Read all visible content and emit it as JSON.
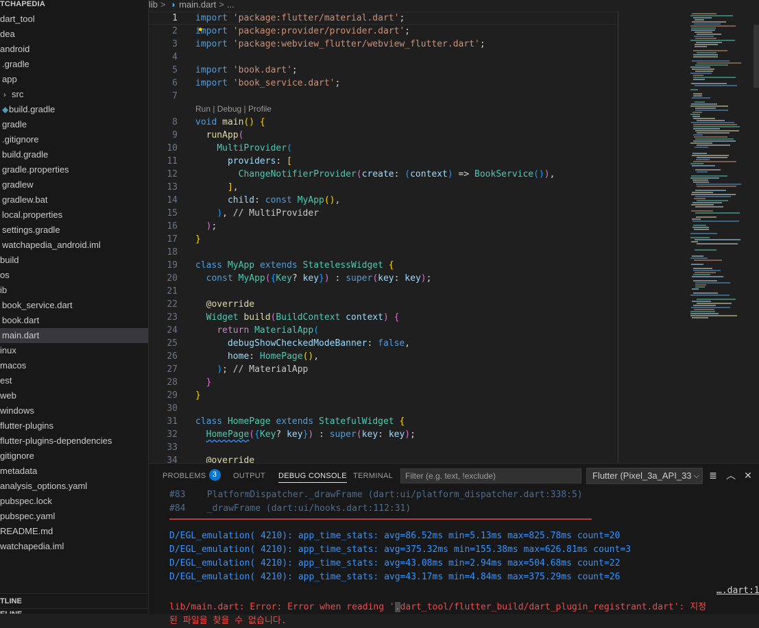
{
  "sidebar": {
    "section_title": "TCHAPEDIA",
    "items": [
      {
        "label": "dart_tool",
        "indent": 0
      },
      {
        "label": "dea",
        "indent": 0
      },
      {
        "label": "android",
        "indent": 0
      },
      {
        "label": ".gradle",
        "indent": 1
      },
      {
        "label": "app",
        "indent": 1
      },
      {
        "label": "src",
        "indent": 2,
        "chevron": true
      },
      {
        "label": "build.gradle",
        "indent": 2,
        "icon": true
      },
      {
        "label": "gradle",
        "indent": 1
      },
      {
        "label": ".gitignore",
        "indent": 1
      },
      {
        "label": "build.gradle",
        "indent": 1
      },
      {
        "label": "gradle.properties",
        "indent": 1
      },
      {
        "label": "gradlew",
        "indent": 1
      },
      {
        "label": "gradlew.bat",
        "indent": 1
      },
      {
        "label": "local.properties",
        "indent": 1
      },
      {
        "label": "settings.gradle",
        "indent": 1
      },
      {
        "label": "watchapedia_android.iml",
        "indent": 1
      },
      {
        "label": "build",
        "indent": 0
      },
      {
        "label": "os",
        "indent": 0
      },
      {
        "label": "ib",
        "indent": 0
      },
      {
        "label": "book_service.dart",
        "indent": 1
      },
      {
        "label": "book.dart",
        "indent": 1
      },
      {
        "label": "main.dart",
        "indent": 1,
        "selected": true
      },
      {
        "label": "inux",
        "indent": 0
      },
      {
        "label": "macos",
        "indent": 0
      },
      {
        "label": "est",
        "indent": 0
      },
      {
        "label": "web",
        "indent": 0
      },
      {
        "label": "windows",
        "indent": 0
      },
      {
        "label": "flutter-plugins",
        "indent": 0
      },
      {
        "label": "flutter-plugins-dependencies",
        "indent": 0
      },
      {
        "label": "gitignore",
        "indent": 0
      },
      {
        "label": "metadata",
        "indent": 0
      },
      {
        "label": "analysis_options.yaml",
        "indent": 0
      },
      {
        "label": "pubspec.lock",
        "indent": 0
      },
      {
        "label": "pubspec.yaml",
        "indent": 0
      },
      {
        "label": "README.md",
        "indent": 0
      },
      {
        "label": "watchapedia.iml",
        "indent": 0
      }
    ],
    "outline_title": "TLINE",
    "timeline_title": "ELINE"
  },
  "breadcrumb": {
    "folder": "lib",
    "file": "main.dart",
    "more": "..."
  },
  "editor": {
    "current_line": 1,
    "codelens": "Run | Debug | Profile",
    "lines": [
      {
        "n": 1,
        "tokens": [
          [
            "kw",
            "import"
          ],
          [
            "plain",
            " "
          ],
          [
            "str",
            "'package:flutter/material.dart'"
          ],
          [
            "plain",
            ";"
          ]
        ]
      },
      {
        "n": 2,
        "tokens": [
          [
            "kw",
            "import"
          ],
          [
            "plain",
            " "
          ],
          [
            "str",
            "'package:provider/provider.dart'"
          ],
          [
            "plain",
            ";"
          ]
        ]
      },
      {
        "n": 3,
        "tokens": [
          [
            "kw",
            "import"
          ],
          [
            "plain",
            " "
          ],
          [
            "str",
            "'package:webview_flutter/webview_flutter.dart'"
          ],
          [
            "plain",
            ";"
          ]
        ]
      },
      {
        "n": 4,
        "tokens": []
      },
      {
        "n": 5,
        "tokens": [
          [
            "kw",
            "import"
          ],
          [
            "plain",
            " "
          ],
          [
            "str",
            "'book.dart'"
          ],
          [
            "plain",
            ";"
          ]
        ]
      },
      {
        "n": 6,
        "tokens": [
          [
            "kw",
            "import"
          ],
          [
            "plain",
            " "
          ],
          [
            "str",
            "'book_service.dart'"
          ],
          [
            "plain",
            ";"
          ]
        ]
      },
      {
        "n": 7,
        "tokens": []
      },
      {
        "n": 8,
        "codelens": true,
        "tokens": [
          [
            "kw",
            "void"
          ],
          [
            "plain",
            " "
          ],
          [
            "fn",
            "main"
          ],
          [
            "b1",
            "()"
          ],
          [
            "plain",
            " "
          ],
          [
            "b1",
            "{"
          ]
        ]
      },
      {
        "n": 9,
        "tokens": [
          [
            "plain",
            "  "
          ],
          [
            "fn",
            "runApp"
          ],
          [
            "b2",
            "("
          ]
        ]
      },
      {
        "n": 10,
        "tokens": [
          [
            "plain",
            "    "
          ],
          [
            "type",
            "MultiProvider"
          ],
          [
            "b3",
            "("
          ]
        ]
      },
      {
        "n": 11,
        "tokens": [
          [
            "plain",
            "      "
          ],
          [
            "var",
            "providers"
          ],
          [
            "plain",
            ": "
          ],
          [
            "b1",
            "["
          ]
        ]
      },
      {
        "n": 12,
        "tokens": [
          [
            "plain",
            "        "
          ],
          [
            "type",
            "ChangeNotifierProvider"
          ],
          [
            "b2",
            "("
          ],
          [
            "var",
            "create"
          ],
          [
            "plain",
            ": "
          ],
          [
            "b3",
            "("
          ],
          [
            "var",
            "context"
          ],
          [
            "b3",
            ")"
          ],
          [
            "plain",
            " => "
          ],
          [
            "type",
            "BookService"
          ],
          [
            "b3",
            "()"
          ],
          [
            "b2",
            ")"
          ],
          [
            "plain",
            ","
          ]
        ]
      },
      {
        "n": 13,
        "tokens": [
          [
            "plain",
            "      "
          ],
          [
            "b1",
            "]"
          ],
          [
            "plain",
            ","
          ]
        ]
      },
      {
        "n": 14,
        "tokens": [
          [
            "plain",
            "      "
          ],
          [
            "var",
            "child"
          ],
          [
            "plain",
            ": "
          ],
          [
            "kw",
            "const"
          ],
          [
            "plain",
            " "
          ],
          [
            "type",
            "MyApp"
          ],
          [
            "b1",
            "()"
          ],
          [
            "plain",
            ","
          ]
        ]
      },
      {
        "n": 15,
        "tokens": [
          [
            "plain",
            "    "
          ],
          [
            "b3",
            ")"
          ],
          [
            "plain",
            ", "
          ],
          [
            "cm",
            "// MultiProvider"
          ]
        ]
      },
      {
        "n": 16,
        "tokens": [
          [
            "plain",
            "  "
          ],
          [
            "b2",
            ")"
          ],
          [
            "plain",
            ";"
          ]
        ]
      },
      {
        "n": 17,
        "tokens": [
          [
            "b1",
            "}"
          ]
        ]
      },
      {
        "n": 18,
        "tokens": []
      },
      {
        "n": 19,
        "tokens": [
          [
            "kw",
            "class"
          ],
          [
            "plain",
            " "
          ],
          [
            "type",
            "MyApp"
          ],
          [
            "plain",
            " "
          ],
          [
            "kw",
            "extends"
          ],
          [
            "plain",
            " "
          ],
          [
            "type",
            "StatelessWidget"
          ],
          [
            "plain",
            " "
          ],
          [
            "b1",
            "{"
          ]
        ]
      },
      {
        "n": 20,
        "tokens": [
          [
            "plain",
            "  "
          ],
          [
            "kw",
            "const"
          ],
          [
            "plain",
            " "
          ],
          [
            "type",
            "MyApp"
          ],
          [
            "b2",
            "("
          ],
          [
            "b3",
            "{"
          ],
          [
            "type",
            "Key"
          ],
          [
            "plain",
            "? "
          ],
          [
            "var",
            "key"
          ],
          [
            "b3",
            "}"
          ],
          [
            "b2",
            ")"
          ],
          [
            "plain",
            " : "
          ],
          [
            "kw",
            "super"
          ],
          [
            "b2",
            "("
          ],
          [
            "var",
            "key"
          ],
          [
            "plain",
            ": "
          ],
          [
            "var",
            "key"
          ],
          [
            "b2",
            ")"
          ],
          [
            "plain",
            ";"
          ]
        ]
      },
      {
        "n": 21,
        "tokens": []
      },
      {
        "n": 22,
        "tokens": [
          [
            "plain",
            "  "
          ],
          [
            "anno",
            "@override"
          ]
        ]
      },
      {
        "n": 23,
        "tokens": [
          [
            "plain",
            "  "
          ],
          [
            "type",
            "Widget"
          ],
          [
            "plain",
            " "
          ],
          [
            "fn",
            "build"
          ],
          [
            "b2",
            "("
          ],
          [
            "type",
            "BuildContext"
          ],
          [
            "plain",
            " "
          ],
          [
            "var",
            "context"
          ],
          [
            "b2",
            ")"
          ],
          [
            "plain",
            " "
          ],
          [
            "b2",
            "{"
          ]
        ]
      },
      {
        "n": 24,
        "tokens": [
          [
            "plain",
            "    "
          ],
          [
            "ctl",
            "return"
          ],
          [
            "plain",
            " "
          ],
          [
            "type",
            "MaterialApp"
          ],
          [
            "b3",
            "("
          ]
        ]
      },
      {
        "n": 25,
        "tokens": [
          [
            "plain",
            "      "
          ],
          [
            "var",
            "debugShowCheckedModeBanner"
          ],
          [
            "plain",
            ": "
          ],
          [
            "kw",
            "false"
          ],
          [
            "plain",
            ","
          ]
        ]
      },
      {
        "n": 26,
        "tokens": [
          [
            "plain",
            "      "
          ],
          [
            "var",
            "home"
          ],
          [
            "plain",
            ": "
          ],
          [
            "type",
            "HomePage"
          ],
          [
            "b1",
            "()"
          ],
          [
            "plain",
            ","
          ]
        ]
      },
      {
        "n": 27,
        "tokens": [
          [
            "plain",
            "    "
          ],
          [
            "b3",
            ")"
          ],
          [
            "plain",
            "; "
          ],
          [
            "cm",
            "// MaterialApp"
          ]
        ]
      },
      {
        "n": 28,
        "tokens": [
          [
            "plain",
            "  "
          ],
          [
            "b2",
            "}"
          ]
        ]
      },
      {
        "n": 29,
        "tokens": [
          [
            "b1",
            "}"
          ]
        ]
      },
      {
        "n": 30,
        "tokens": []
      },
      {
        "n": 31,
        "tokens": [
          [
            "kw",
            "class"
          ],
          [
            "plain",
            " "
          ],
          [
            "type",
            "HomePage"
          ],
          [
            "plain",
            " "
          ],
          [
            "kw",
            "extends"
          ],
          [
            "plain",
            " "
          ],
          [
            "type",
            "StatefulWidget"
          ],
          [
            "plain",
            " "
          ],
          [
            "b1",
            "{"
          ]
        ]
      },
      {
        "n": 32,
        "tokens": [
          [
            "plain",
            "  "
          ],
          [
            "typesq",
            "HomePage"
          ],
          [
            "b2",
            "("
          ],
          [
            "b3",
            "{"
          ],
          [
            "type",
            "Key"
          ],
          [
            "plain",
            "? "
          ],
          [
            "var",
            "key"
          ],
          [
            "b3",
            "}"
          ],
          [
            "b2",
            ")"
          ],
          [
            "plain",
            " : "
          ],
          [
            "kw",
            "super"
          ],
          [
            "b2",
            "("
          ],
          [
            "var",
            "key"
          ],
          [
            "plain",
            ": "
          ],
          [
            "var",
            "key"
          ],
          [
            "b2",
            ")"
          ],
          [
            "plain",
            ";"
          ]
        ]
      },
      {
        "n": 33,
        "tokens": []
      },
      {
        "n": 34,
        "tokens": [
          [
            "plain",
            "  "
          ],
          [
            "anno",
            "@override"
          ]
        ]
      }
    ]
  },
  "panel": {
    "tabs": [
      {
        "label": "PROBLEMS",
        "badge": "3"
      },
      {
        "label": "OUTPUT"
      },
      {
        "label": "DEBUG CONSOLE",
        "active": true
      },
      {
        "label": "TERMINAL"
      }
    ],
    "filter_placeholder": "Filter (e.g. text, !exclude)",
    "device_select": "Flutter (Pixel_3a_API_33",
    "console": [
      {
        "style": "dim",
        "text": "#83    PlatformDispatcher._drawFrame (dart:ui/platform_dispatcher.dart:338:5)"
      },
      {
        "style": "dim",
        "text": "#84    _drawFrame (dart:ui/hooks.dart:112:31)"
      },
      {
        "style": "blue",
        "text": "D/EGL_emulation( 4210): app_time_stats: avg=86.52ms min=5.13ms max=825.78ms count=20"
      },
      {
        "style": "blue",
        "text": "D/EGL_emulation( 4210): app_time_stats: avg=375.32ms min=155.38ms max=626.81ms count=3"
      },
      {
        "style": "blue",
        "text": "D/EGL_emulation( 4210): app_time_stats: avg=43.08ms min=2.94ms max=504.68ms count=22"
      },
      {
        "style": "blue",
        "text": "D/EGL_emulation( 4210): app_time_stats: avg=43.17ms min=4.84ms max=375.29ms count=26"
      }
    ],
    "error_prefix": "lib/main.dart: Error: Error when reading '",
    "error_highlight": ".",
    "error_path": "dart_tool/flutter_build/dart_plugin_registrant.dart': 지정",
    "error_line2": "된 파일을 찾을 수 없습니다.",
    "error_link": "….dart:1"
  },
  "icons": {
    "chevron": "chevron-right-icon",
    "more_actions": "list-filter-icon",
    "collapse": "chevron-up-icon",
    "close": "close-icon"
  }
}
